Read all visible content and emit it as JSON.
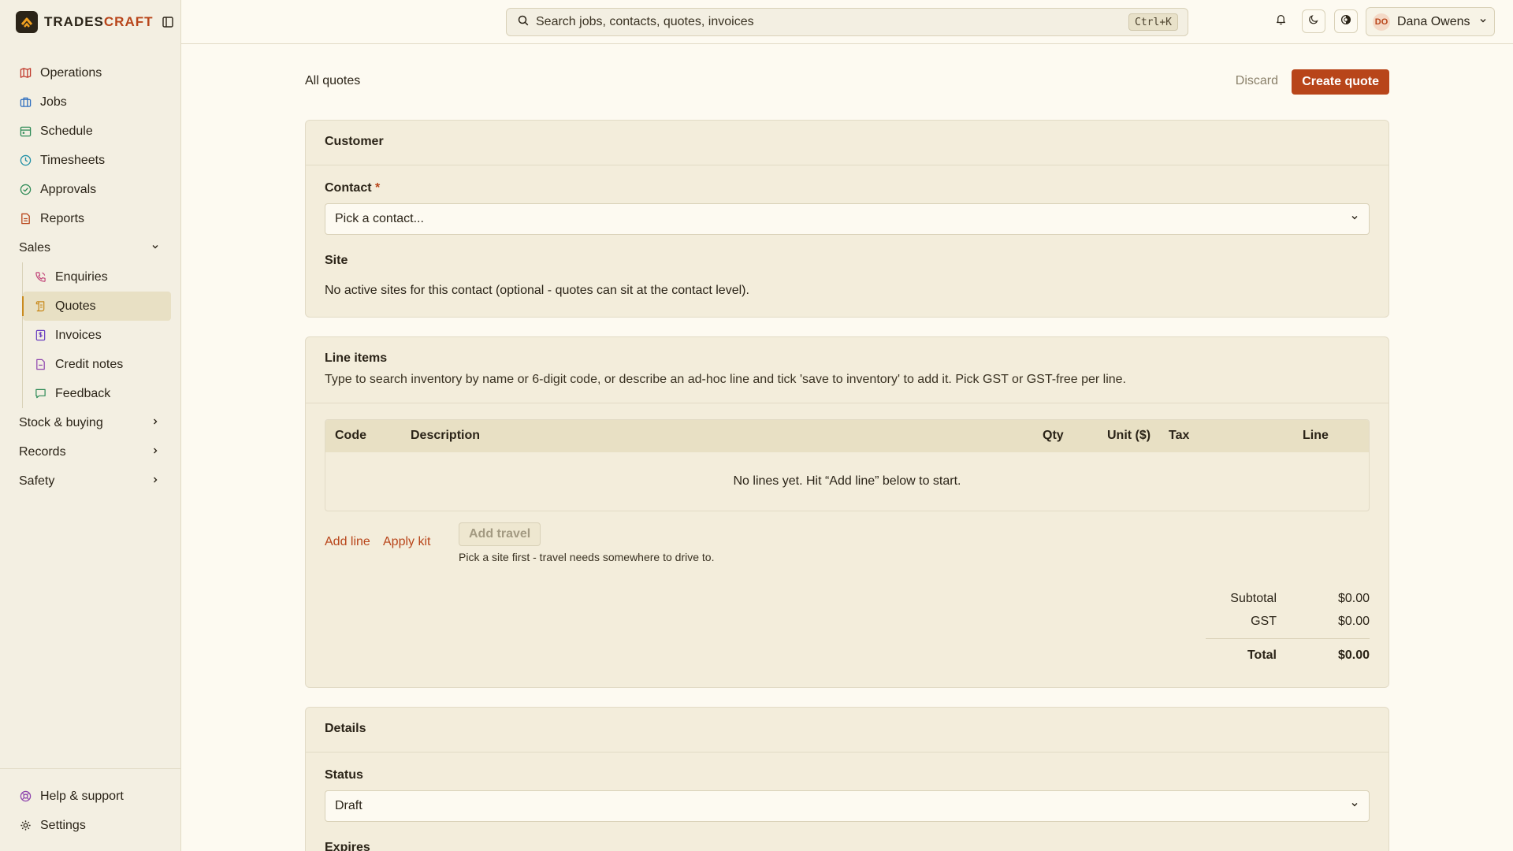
{
  "brand": {
    "prefix": "TRADES",
    "suffix": "CRAFT"
  },
  "search": {
    "placeholder": "Search jobs, contacts, quotes, invoices",
    "shortcut": "Ctrl+K"
  },
  "user": {
    "initials": "DO",
    "name": "Dana Owens"
  },
  "nav": {
    "items": [
      {
        "label": "Operations",
        "icon": "map-icon",
        "color": "#c0392b"
      },
      {
        "label": "Jobs",
        "icon": "briefcase-icon",
        "color": "#2e6fbf"
      },
      {
        "label": "Schedule",
        "icon": "calendar-icon",
        "color": "#2e8b57"
      },
      {
        "label": "Timesheets",
        "icon": "clock-icon",
        "color": "#1f8fa6"
      },
      {
        "label": "Approvals",
        "icon": "check-circle-icon",
        "color": "#2e8b57"
      },
      {
        "label": "Reports",
        "icon": "document-icon",
        "color": "#b8451a"
      }
    ],
    "sales": {
      "label": "Sales",
      "items": [
        {
          "label": "Enquiries",
          "icon": "phone-icon",
          "color": "#c2477a"
        },
        {
          "label": "Quotes",
          "icon": "scroll-icon",
          "color": "#c98a1e"
        },
        {
          "label": "Invoices",
          "icon": "invoice-icon",
          "color": "#6a3fc0"
        },
        {
          "label": "Credit notes",
          "icon": "file-icon",
          "color": "#8e44ad"
        },
        {
          "label": "Feedback",
          "icon": "message-icon",
          "color": "#2e8b57"
        }
      ]
    },
    "groups": [
      {
        "label": "Stock & buying"
      },
      {
        "label": "Records"
      },
      {
        "label": "Safety"
      }
    ],
    "bottom": [
      {
        "label": "Help & support",
        "icon": "lifebuoy-icon",
        "color": "#8e44ad"
      },
      {
        "label": "Settings",
        "icon": "gear-icon",
        "color": "#2b2418"
      }
    ]
  },
  "page": {
    "back_link": "All quotes",
    "discard": "Discard",
    "create": "Create quote"
  },
  "customer": {
    "title": "Customer",
    "contact_label": "Contact",
    "required_mark": "*",
    "contact_placeholder": "Pick a contact...",
    "site_label": "Site",
    "site_note": "No active sites for this contact (optional - quotes can sit at the contact level)."
  },
  "line_items": {
    "title": "Line items",
    "subtitle": "Type to search inventory by name or 6-digit code, or describe an ad-hoc line and tick 'save to inventory' to add it. Pick GST or GST-free per line.",
    "columns": [
      "Code",
      "Description",
      "Qty",
      "Unit ($)",
      "Tax",
      "Line"
    ],
    "empty": "No lines yet. Hit “Add line” below to start.",
    "add_line": "Add line",
    "apply_kit": "Apply kit",
    "add_travel": "Add travel",
    "travel_hint": "Pick a site first - travel needs somewhere to drive to.",
    "subtotal_label": "Subtotal",
    "subtotal": "$0.00",
    "gst_label": "GST",
    "gst": "$0.00",
    "total_label": "Total",
    "total": "$0.00"
  },
  "details": {
    "title": "Details",
    "status_label": "Status",
    "status_value": "Draft",
    "expires_label": "Expires"
  },
  "colors": {
    "accent": "#b8451a",
    "background": "#fdfaf1",
    "sidebar": "#f3efe2"
  }
}
